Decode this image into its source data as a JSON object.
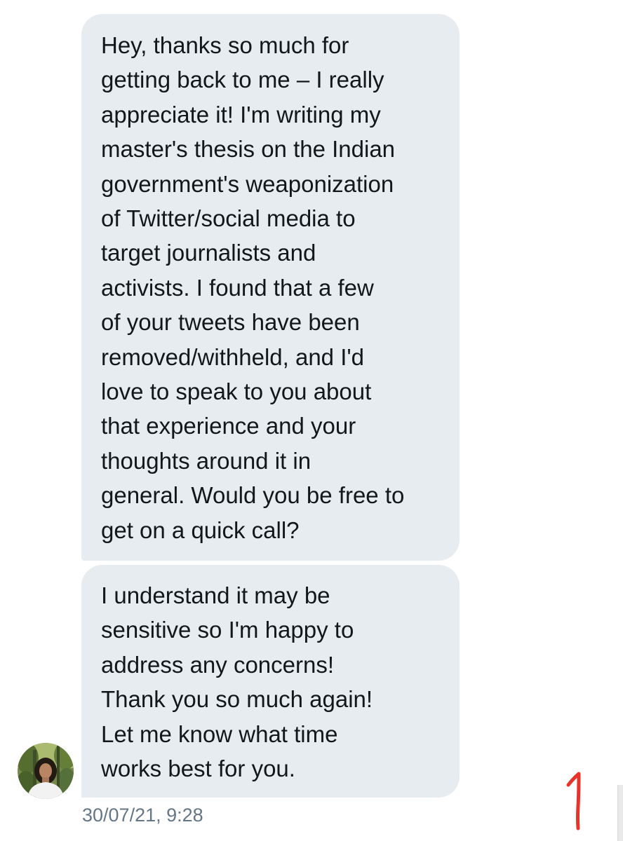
{
  "conversation": {
    "messages": [
      {
        "lines": [
          "Hey, thanks so much for",
          "getting back to me – I really",
          "appreciate it! I'm writing my",
          "master's thesis on the Indian",
          "government's weaponization",
          "of Twitter/social media to",
          "target journalists and",
          "activists. I found that a few",
          "of your tweets have been",
          "removed/withheld, and I'd",
          "love to speak to you about",
          "that experience and your",
          "thoughts around it in",
          "general. Would you be free to",
          "get on a quick call?"
        ]
      },
      {
        "lines": [
          "I understand it may be",
          "sensitive so I'm happy to",
          "address any concerns!",
          "Thank you so much again!",
          "Let me know what time",
          "works best for you."
        ]
      }
    ],
    "timestamp": "30/07/21, 9:28",
    "annotation_number": "1"
  },
  "colors": {
    "bubble_background": "#e6ecf0",
    "message_text": "#14171a",
    "timestamp_text": "#657786",
    "annotation_red": "#e8332a"
  }
}
